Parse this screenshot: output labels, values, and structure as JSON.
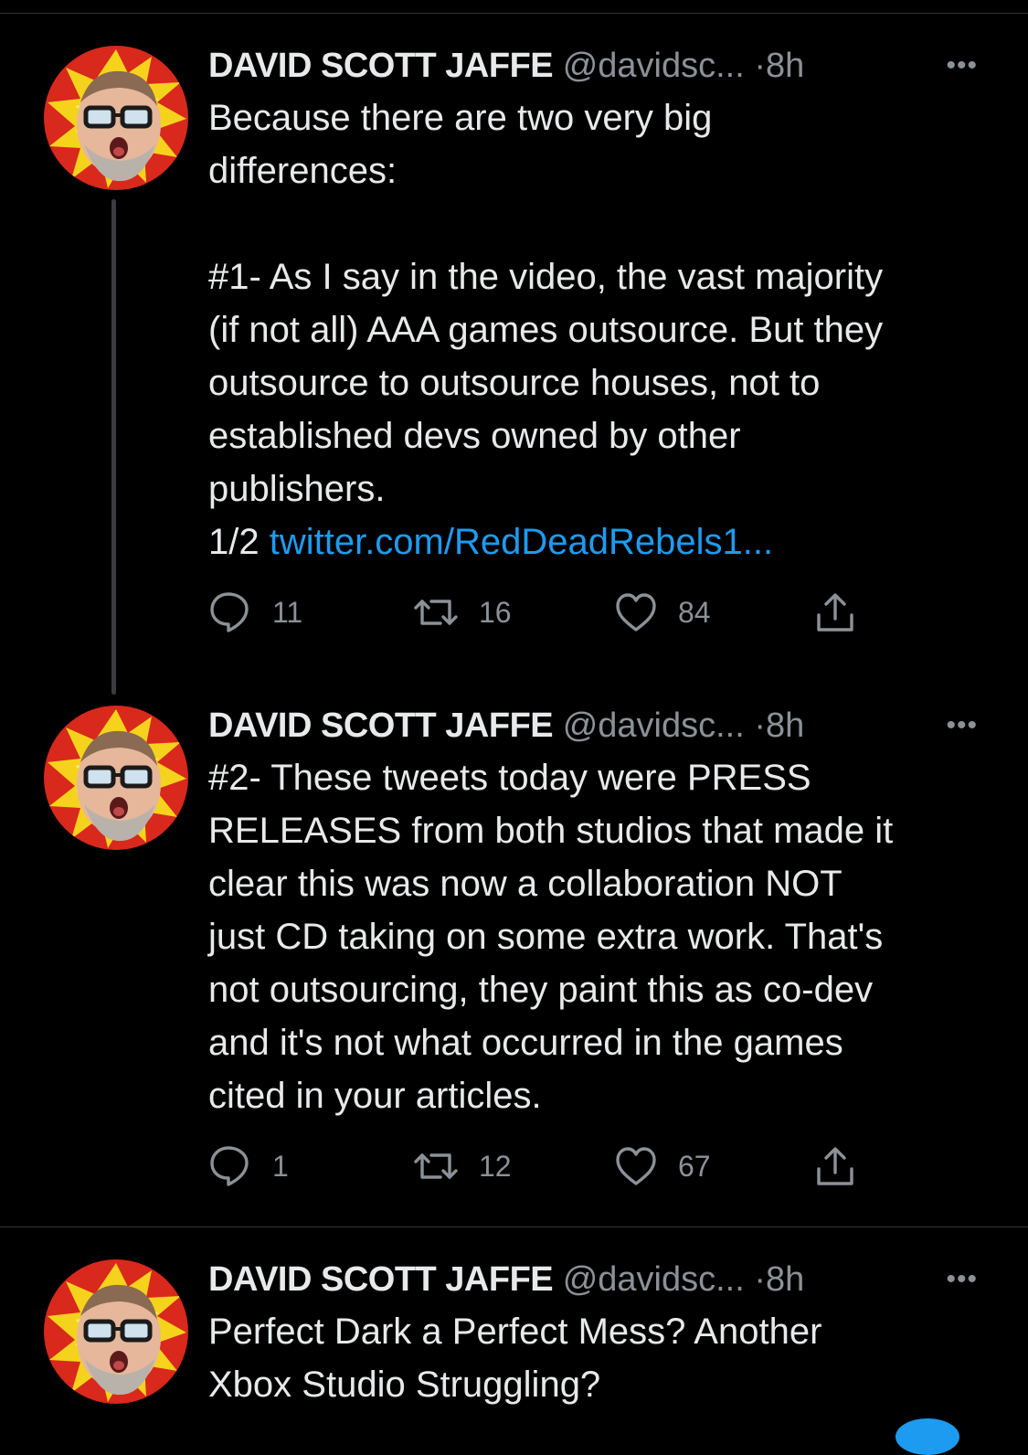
{
  "tweets": [
    {
      "name": "DAVID SCOTT JAFFE",
      "handle": "@davidsc...",
      "separator": "·",
      "time": "8h",
      "more": "•••",
      "text": "Because there are two very big\ndifferences:\n\n#1- As I say in the video, the vast majority\n(if not all) AAA games outsource. But they\noutsource to outsource houses, not to\nestablished devs owned by other\npublishers.\n1/2 ",
      "link": "twitter.com/RedDeadRebels1...",
      "replies": "11",
      "retweets": "16",
      "likes": "84"
    },
    {
      "name": "DAVID SCOTT JAFFE",
      "handle": "@davidsc...",
      "separator": "·",
      "time": "8h",
      "more": "•••",
      "text": "#2- These tweets today were PRESS\nRELEASES from both studios that made it\nclear this was now a collaboration NOT\njust CD taking on some extra work. That's\nnot outsourcing, they paint this as co-dev\nand it's not what occurred in the games\ncited in your articles.",
      "replies": "1",
      "retweets": "12",
      "likes": "67"
    },
    {
      "name": "DAVID SCOTT JAFFE",
      "handle": "@davidsc...",
      "separator": "·",
      "time": "8h",
      "more": "•••",
      "text": "Perfect Dark a Perfect Mess? Another\nXbox Studio Struggling?"
    }
  ],
  "icons": {
    "reply": "reply-icon",
    "retweet": "retweet-icon",
    "like": "heart-icon",
    "share": "share-icon"
  },
  "colors": {
    "background": "#000000",
    "text": "#e7e9ea",
    "secondary": "#8b9197",
    "link": "#1d9bf0",
    "divider": "#2f3336"
  }
}
